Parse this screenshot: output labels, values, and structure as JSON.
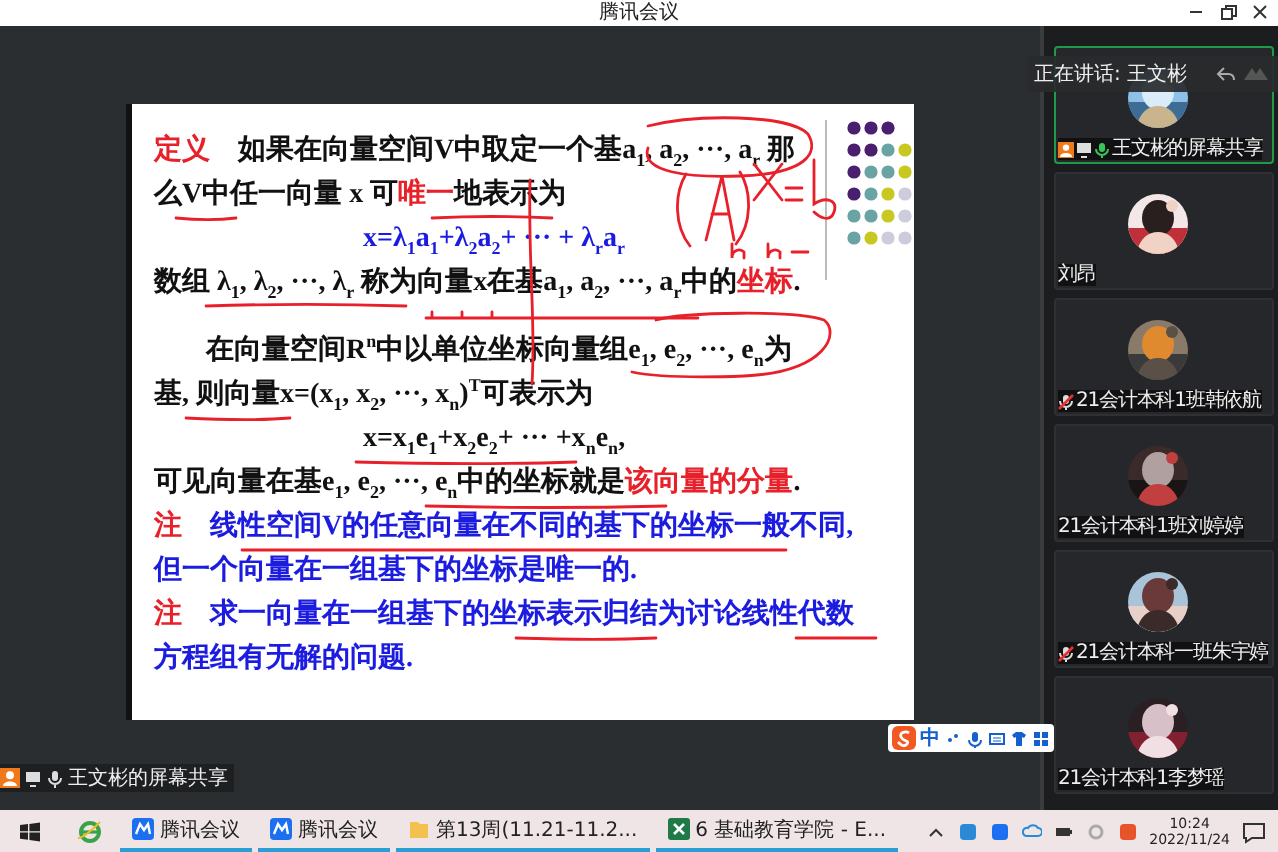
{
  "window": {
    "title": "腾讯会议"
  },
  "speaking": {
    "label": "正在讲话: 王文彬"
  },
  "slide": {
    "lines": [
      {
        "kind": "text",
        "segments": [
          {
            "color": "#e8202a",
            "text": "定义"
          },
          {
            "color": "#111111",
            "text": "　如果在向量空间V中取定一个基a$_{1}$, a$_{2}$, ···, a$_{r}$ 那"
          }
        ]
      },
      {
        "kind": "text",
        "segments": [
          {
            "color": "#111111",
            "text": "么V中任一向量 x 可"
          },
          {
            "color": "#e8202a",
            "text": "唯一"
          },
          {
            "color": "#111111",
            "text": "地表示为"
          }
        ]
      },
      {
        "kind": "formula",
        "segments": [
          {
            "color": "#1c1ce0",
            "text": "x=λ$_{1}$a$_{1}$+λ$_{2}$a$_{2}$+ ··· + λ$_{r}$a$_{r}$"
          }
        ]
      },
      {
        "kind": "text",
        "segments": [
          {
            "color": "#111111",
            "text": "数组 λ$_{1}$, λ$_{2}$, ···, λ$_{r}$ 称为向量x在基a$_{1}$, a$_{2}$, ···, a$_{r}$中的"
          },
          {
            "color": "#e8202a",
            "text": "坐标"
          },
          {
            "color": "#111111",
            "text": "."
          }
        ]
      },
      {
        "kind": "indented",
        "segments": [
          {
            "color": "#111111",
            "text": "在向量空间**R**$^{n}$中以单位坐标向量组e$_{1}$, e$_{2}$, ···, e$_{n}$为"
          }
        ]
      },
      {
        "kind": "text",
        "segments": [
          {
            "color": "#111111",
            "text": "基, 则向量x=(x$_{1}$, x$_{2}$, ···, x$_{n}$)$^{T}$可表示为"
          }
        ]
      },
      {
        "kind": "formula",
        "segments": [
          {
            "color": "#111111",
            "text": "x=x$_{1}$e$_{1}$+x$_{2}$e$_{2}$+ ··· +x$_{n}$e$_{n}$,"
          }
        ]
      },
      {
        "kind": "text",
        "segments": [
          {
            "color": "#111111",
            "text": "可见向量在基e$_{1}$, e$_{2}$, ···, e$_{n}$中的坐标就是"
          },
          {
            "color": "#e8202a",
            "text": "该向量的分量"
          },
          {
            "color": "#111111",
            "text": "."
          }
        ]
      },
      {
        "kind": "text",
        "segments": [
          {
            "color": "#e8202a",
            "text": "注"
          },
          {
            "color": "#1c1ce0",
            "text": "　线性空间V的任意向量在不同的基下的坐标一般不同,"
          }
        ]
      },
      {
        "kind": "text",
        "segments": [
          {
            "color": "#1c1ce0",
            "text": "但一个向量在一组基下的坐标是唯一的."
          }
        ]
      },
      {
        "kind": "text",
        "segments": [
          {
            "color": "#e8202a",
            "text": "注"
          },
          {
            "color": "#1c1ce0",
            "text": "　求一向量在一组基下的坐标表示归结为讨论线性代数"
          }
        ]
      },
      {
        "kind": "text",
        "segments": [
          {
            "color": "#1c1ce0",
            "text": "方程组有无解的问题."
          }
        ]
      }
    ]
  },
  "share_badge": {
    "label": "王文彬的屏幕共享"
  },
  "ime": {
    "mode": "中"
  },
  "participants": [
    {
      "name": "王文彬的屏幕共享",
      "speaking": true,
      "host": true,
      "mic_icon": true,
      "muted": false
    },
    {
      "name": "刘昂",
      "speaking": false,
      "host": false,
      "mic_icon": false,
      "muted": false
    },
    {
      "name": "21会计本科1班韩依航",
      "speaking": false,
      "host": false,
      "mic_icon": true,
      "muted": true
    },
    {
      "name": "21会计本科1班刘婷婷",
      "speaking": false,
      "host": false,
      "mic_icon": false,
      "muted": false
    },
    {
      "name": "21会计本科一班朱宇婷",
      "speaking": false,
      "host": false,
      "mic_icon": true,
      "muted": true
    },
    {
      "name": "21会计本科1李梦瑶",
      "speaking": false,
      "host": false,
      "mic_icon": false,
      "muted": false
    }
  ],
  "taskbar": {
    "items": [
      {
        "kind": "meeting",
        "label": "腾讯会议",
        "running": true
      },
      {
        "kind": "meeting",
        "label": "腾讯会议",
        "running": true
      },
      {
        "kind": "folder",
        "label": "第13周(11.21-11.2...",
        "running": true
      },
      {
        "kind": "excel",
        "label": "6 基础教育学院 - E...",
        "running": true
      }
    ],
    "time": "10:24",
    "date": "2022/11/24"
  }
}
